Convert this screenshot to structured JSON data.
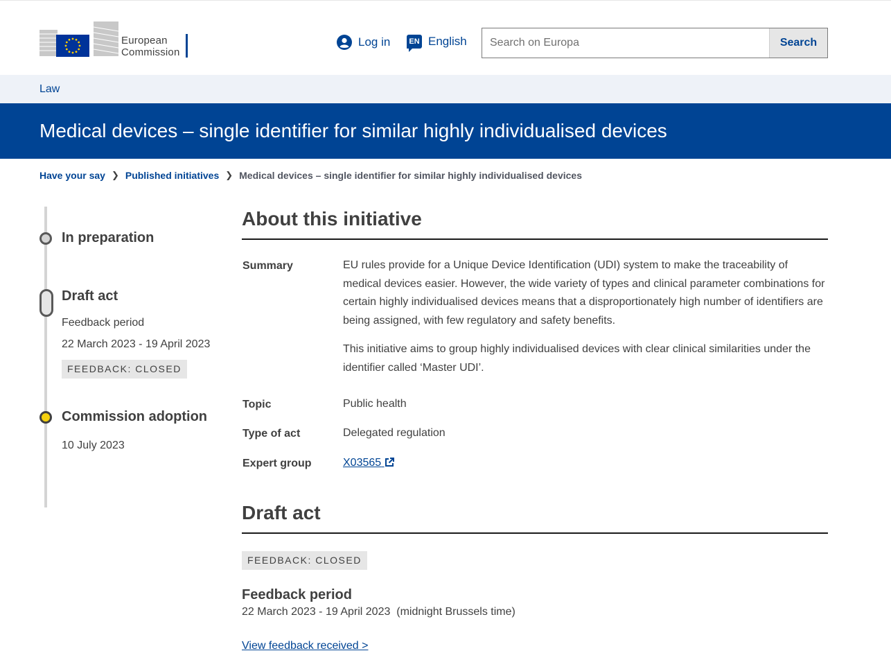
{
  "header": {
    "logo_line1": "European",
    "logo_line2": "Commission",
    "login_label": "Log in",
    "lang_code": "EN",
    "lang_label": "English",
    "search_placeholder": "Search on Europa",
    "search_button": "Search"
  },
  "site": {
    "name": "Law"
  },
  "page": {
    "title": "Medical devices – single identifier for similar highly individualised devices"
  },
  "breadcrumb": [
    {
      "label": "Have your say"
    },
    {
      "label": "Published initiatives"
    },
    {
      "label": "Medical devices – single identifier for similar highly individualised devices"
    }
  ],
  "timeline": {
    "stage1": {
      "title": "In preparation"
    },
    "stage2": {
      "title": "Draft act",
      "label": "Feedback period",
      "dates": "22 March 2023 - 19 April 2023",
      "status": "FEEDBACK: CLOSED"
    },
    "stage3": {
      "title": "Commission adoption",
      "date": "10 July 2023"
    }
  },
  "about": {
    "heading": "About this initiative",
    "summary_label": "Summary",
    "summary_p1": "EU rules provide for a Unique Device Identification (UDI) system to make the traceability of medical devices easier. However, the wide variety of types and clinical parameter combinations for certain highly individualised devices means that a disproportionately high number of identifiers are being assigned, with few regulatory and safety benefits.",
    "summary_p2": "This initiative aims to group highly individualised devices with clear clinical similarities under the identifier called ‘Master UDI’.",
    "topic_label": "Topic",
    "topic_value": "Public health",
    "type_label": "Type of act",
    "type_value": "Delegated regulation",
    "expert_label": "Expert group",
    "expert_value": "X03565"
  },
  "draft": {
    "heading": "Draft act",
    "status": "FEEDBACK: CLOSED",
    "period_title": "Feedback period",
    "period_dates": "22 March 2023 - 19 April 2023  (midnight Brussels time)",
    "view_link": "View feedback received >"
  },
  "colors": {
    "primary": "#004494",
    "accent": "#f5d10f",
    "band": "#eef2f8"
  }
}
